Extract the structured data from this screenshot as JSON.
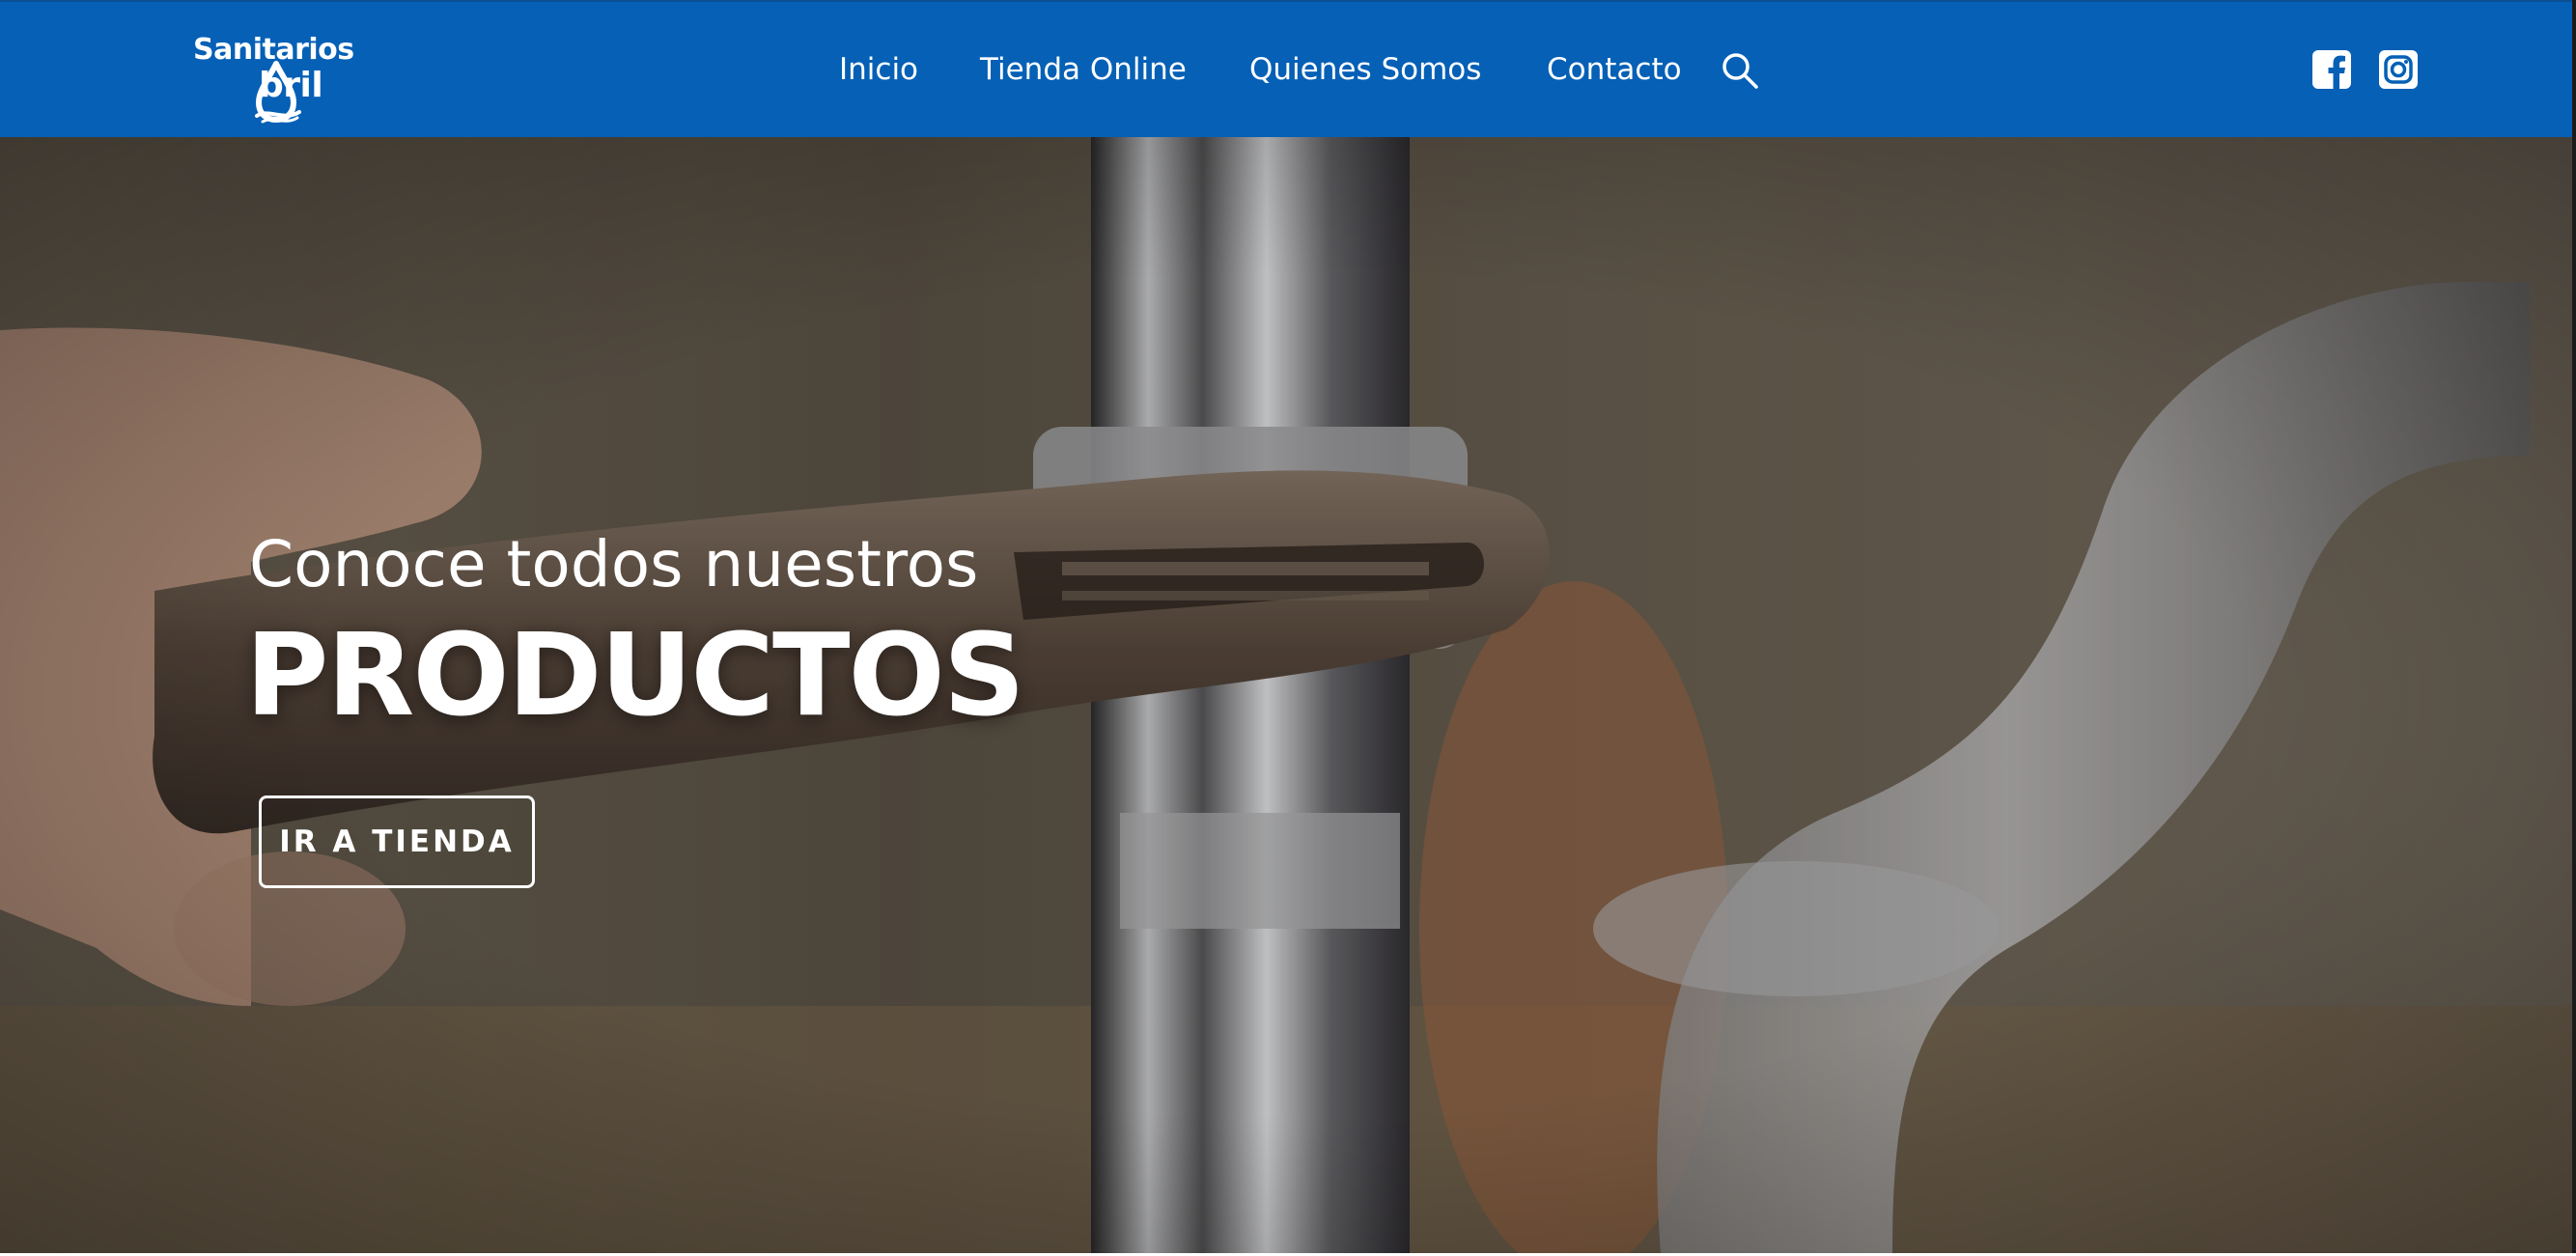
{
  "brand": {
    "line1": "Sanitarios",
    "line2": "bril",
    "logo_icon": "water-drop-a-icon"
  },
  "nav": {
    "items": [
      {
        "label": "Inicio"
      },
      {
        "label": "Tienda Online"
      },
      {
        "label": "Quienes Somos"
      },
      {
        "label": "Contacto"
      }
    ],
    "search_icon": "search-icon"
  },
  "social": {
    "facebook_icon": "facebook-icon",
    "instagram_icon": "instagram-icon"
  },
  "hero": {
    "subtitle": "Conoce todos nuestros",
    "title": "PRODUCTOS",
    "cta_label": "IR A TIENDA",
    "background": "plumber-wrench-pipe-photo"
  },
  "colors": {
    "header_bg": "#0560b6",
    "text": "#ffffff"
  }
}
